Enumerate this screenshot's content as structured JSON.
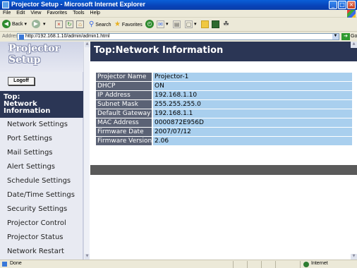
{
  "window": {
    "title": "Projector Setup - Microsoft Internet Explorer",
    "buttons": {
      "minimize": "_",
      "maximize": "□",
      "close": "×"
    }
  },
  "menu": [
    "File",
    "Edit",
    "View",
    "Favorites",
    "Tools",
    "Help"
  ],
  "toolbar": {
    "back": "Back",
    "search": "Search",
    "favorites": "Favorites"
  },
  "address": {
    "label": "Address",
    "url": "http://192.168.1.10/admin/admin1.html",
    "go": "Go"
  },
  "sidebar": {
    "logo": "Projector Setup",
    "logoff": "Logoff",
    "current": "Top:\nNetwork\nInformation",
    "current_lines": [
      "Top:",
      "Network",
      "Information"
    ],
    "items": [
      "Network Settings",
      "Port Settings",
      "Mail Settings",
      "Alert Settings",
      "Schedule Settings",
      "Date/Time Settings",
      "Security Settings",
      "Projector Control",
      "Projector Status",
      "Network Restart"
    ]
  },
  "main": {
    "title": "Top:Network Information",
    "rows": [
      {
        "label": "Projector Name",
        "value": "Projector-1"
      },
      {
        "label": "DHCP",
        "value": "ON"
      },
      {
        "label": "IP Address",
        "value": "192.168.1.10"
      },
      {
        "label": "Subnet Mask",
        "value": "255.255.255.0"
      },
      {
        "label": "Default Gateway",
        "value": "192.168.1.1"
      },
      {
        "label": "MAC Address",
        "value": "0000872E956D"
      },
      {
        "label": "Firmware Date",
        "value": "2007/07/12"
      },
      {
        "label": "Firmware Version",
        "value": "2.06"
      }
    ]
  },
  "status": {
    "text": "Done",
    "zone": "Internet"
  },
  "colors": {
    "header_bg": "#2b3655",
    "label_bg": "#5b6275",
    "value_bg": "#a9cfee",
    "footer_bar": "#5a5a5a"
  }
}
